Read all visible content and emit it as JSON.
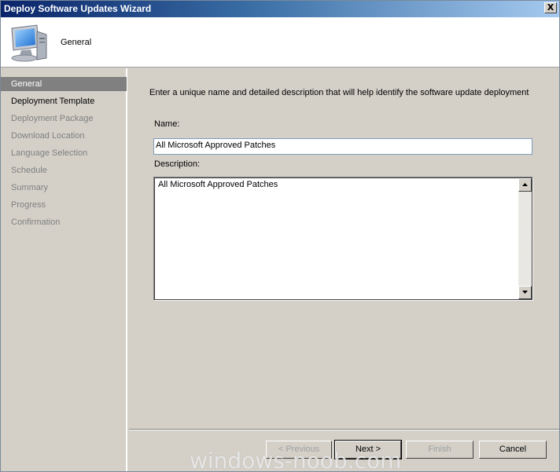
{
  "window": {
    "title": "Deploy Software Updates Wizard",
    "close_glyph": "X"
  },
  "header": {
    "title": "General",
    "icon": "computer-icon"
  },
  "nav": {
    "items": [
      {
        "label": "General",
        "state": "active"
      },
      {
        "label": "Deployment Template",
        "state": "current"
      },
      {
        "label": "Deployment Package",
        "state": "disabled"
      },
      {
        "label": "Download Location",
        "state": "disabled"
      },
      {
        "label": "Language Selection",
        "state": "disabled"
      },
      {
        "label": "Schedule",
        "state": "disabled"
      },
      {
        "label": "Summary",
        "state": "disabled"
      },
      {
        "label": "Progress",
        "state": "disabled"
      },
      {
        "label": "Confirmation",
        "state": "disabled"
      }
    ]
  },
  "main": {
    "instruction": "Enter a unique name and detailed description that will help identify the software update deployment",
    "name_label": "Name:",
    "name_value": "All Microsoft Approved Patches",
    "description_label": "Description:",
    "description_value": "All Microsoft Approved Patches"
  },
  "footer": {
    "prev_label": "< Previous",
    "next_label": "Next >",
    "finish_label": "Finish",
    "cancel_label": "Cancel"
  },
  "watermark": "windows-noob.com"
}
